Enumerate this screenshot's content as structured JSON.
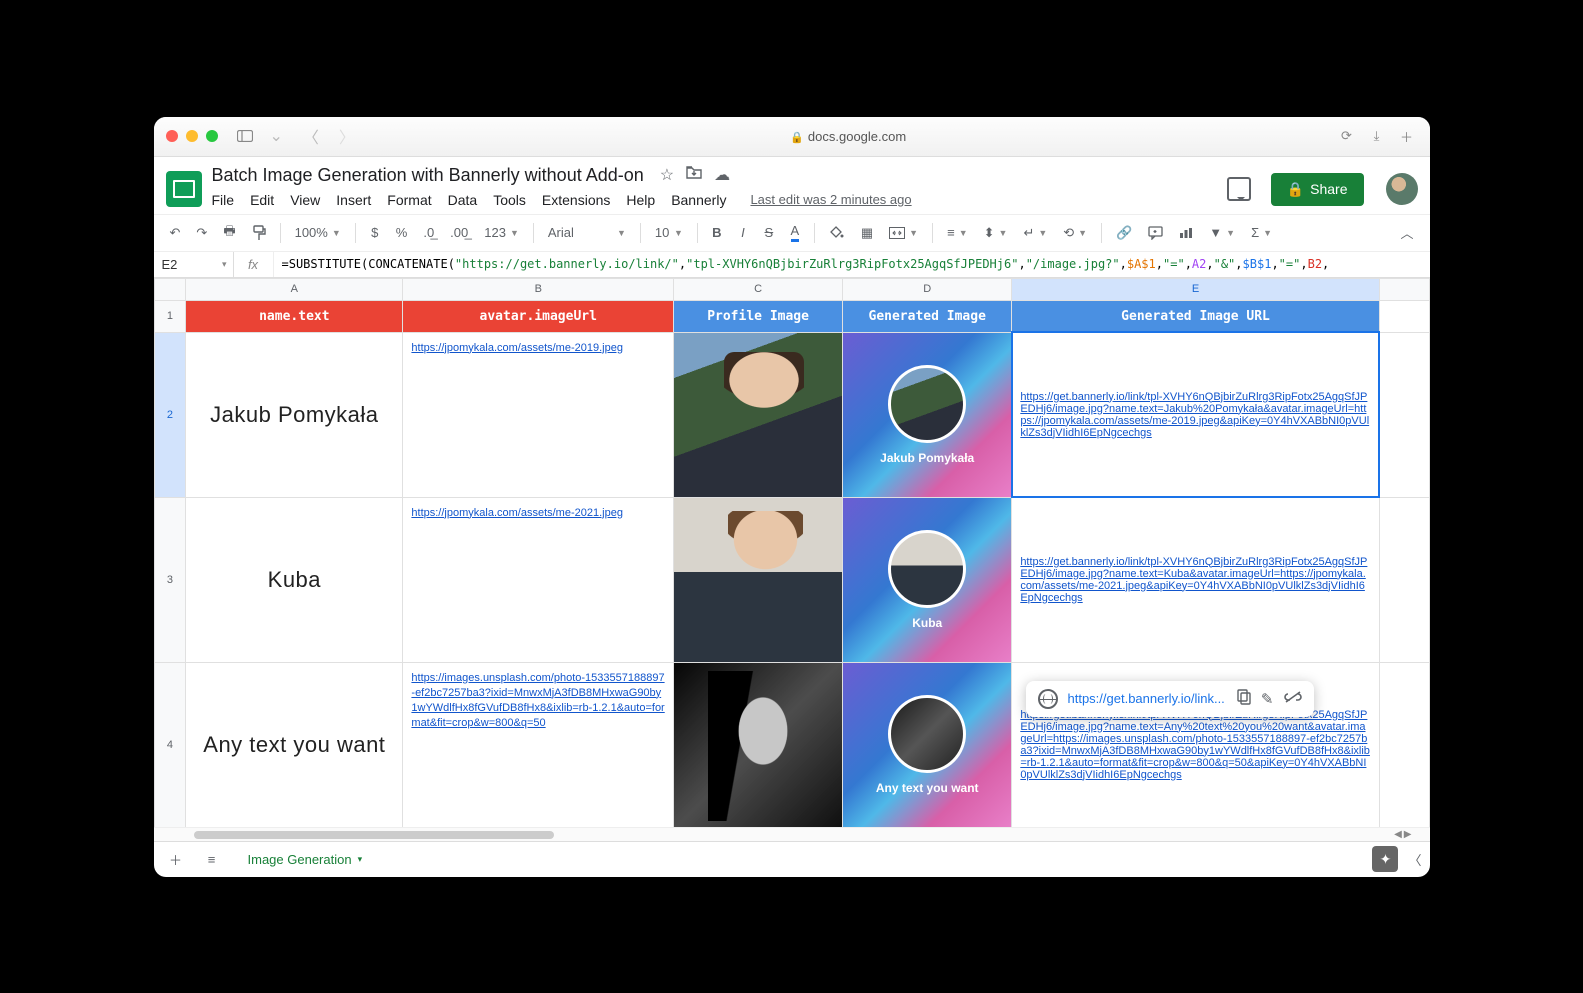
{
  "browser": {
    "url_host": "docs.google.com"
  },
  "doc": {
    "title": "Batch Image Generation with Bannerly without Add-on",
    "last_edit": "Last edit was 2 minutes ago"
  },
  "menus": [
    "File",
    "Edit",
    "View",
    "Insert",
    "Format",
    "Data",
    "Tools",
    "Extensions",
    "Help",
    "Bannerly"
  ],
  "share_label": "Share",
  "toolbar": {
    "zoom": "100%",
    "font": "Arial",
    "size": "10",
    "format_num": "123"
  },
  "name_box": "E2",
  "formula_parts": {
    "prefix": "=",
    "f1": "SUBSTITUTE(",
    "f2": "CONCATENATE(",
    "s1": "\"https://get.bannerly.io/link/\"",
    "s2": "\"tpl-XVHY6nQBjbirZuRlrg3RipFotx25AgqSfJPEDHj6\"",
    "s3": "\"/image.jpg?\"",
    "r1": "$A$1",
    "s4": "\"=\"",
    "r2": "A2",
    "s5": "\"&\"",
    "r3": "$B$1",
    "s6": "\"=\"",
    "r4": "B2",
    "tail": ","
  },
  "columns": [
    "A",
    "B",
    "C",
    "D",
    "E",
    ""
  ],
  "header_row": {
    "A": "name.text",
    "B": "avatar.imageUrl",
    "C": "Profile Image",
    "D": "Generated Image",
    "E": "Generated Image URL"
  },
  "rows": [
    {
      "n": "2",
      "name": "Jakub Pomykała",
      "avatar_url": "https://jpomykala.com/assets/me-2019.jpeg",
      "gen_caption": "Jakub Pomykała",
      "gen_url": "https://get.bannerly.io/link/tpl-XVHY6nQBjbirZuRlrg3RipFotx25AgqSfJPEDHj6/image.jpg?name.text=Jakub%20Pomykała&avatar.imageUrl=https://jpomykala.com/assets/me-2019.jpeg&apiKey=0Y4hVXABbNI0pVUlklZs3djVIidhI6EpNgcechgs"
    },
    {
      "n": "3",
      "name": "Kuba",
      "avatar_url": "https://jpomykala.com/assets/me-2021.jpeg",
      "gen_caption": "Kuba",
      "gen_url": "https://get.bannerly.io/link/tpl-XVHY6nQBjbirZuRlrg3RipFotx25AgqSfJPEDHj6/image.jpg?name.text=Kuba&avatar.imageUrl=https://jpomykala.com/assets/me-2021.jpeg&apiKey=0Y4hVXABbNI0pVUlklZs3djVIidhI6EpNgcechgs"
    },
    {
      "n": "4",
      "name": "Any text you want",
      "avatar_url": "https://images.unsplash.com/photo-1533557188897-ef2bc7257ba3?ixid=MnwxMjA3fDB8MHxwaG90by1wYWdlfHx8fGVufDB8fHx8&ixlib=rb-1.2.1&auto=format&fit=crop&w=800&q=50",
      "gen_caption": "Any text you want",
      "gen_url": "https://get.bannerly.io/link/tpl-XVHY6nQBjbirZuRlrg3RipFotx25AgqSfJPEDHj6/image.jpg?name.text=Any%20text%20you%20want&avatar.imageUrl=https://images.unsplash.com/photo-1533557188897-ef2bc7257ba3?ixid=MnwxMjA3fDB8MHxwaG90by1wYWdlfHx8fGVufDB8fHx8&ixlib=rb-1.2.1&auto=format&fit=crop&w=800&q=50&apiKey=0Y4hVXABbNI0pVUlklZs3djVIidhI6EpNgcechgs"
    }
  ],
  "popover": {
    "link_text": "https://get.bannerly.io/link..."
  },
  "sheet_tab": "Image Generation"
}
